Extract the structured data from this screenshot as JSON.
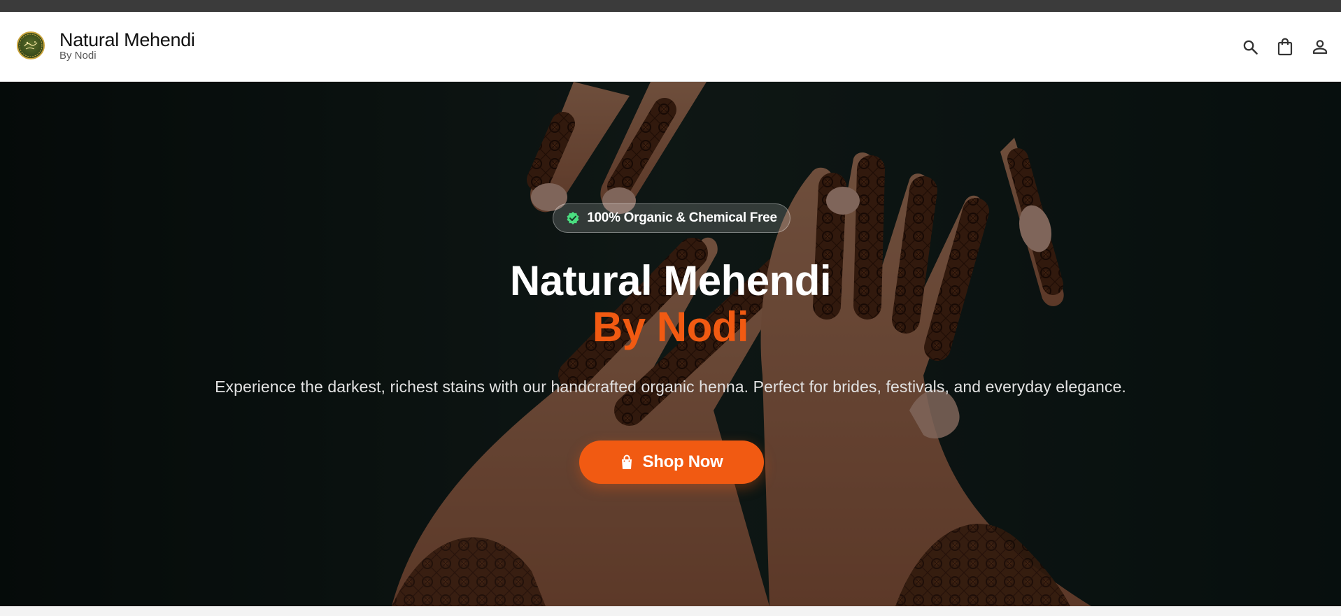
{
  "header": {
    "brand_name": "Natural Mehendi",
    "brand_sub": "By Nodi",
    "icons": [
      "search-icon",
      "shopping-bag-icon",
      "user-icon"
    ]
  },
  "hero": {
    "badge": "100% Organic & Chemical Free",
    "badge_icon": "verified-check-icon",
    "title": "Natural Mehendi",
    "title_accent": "By Nodi",
    "subtitle": "Experience the darkest, richest stains with our handcrafted organic henna. Perfect for brides, festivals, and everyday elegance.",
    "cta_label": "Shop Now",
    "cta_icon": "shopping-bag-icon",
    "background_image": "hands-with-henna-designs"
  },
  "colors": {
    "accent": "#f15a12",
    "badge_check": "#4ade80",
    "topbar": "#3b3b3b",
    "hero_background": "#0d1a18"
  }
}
